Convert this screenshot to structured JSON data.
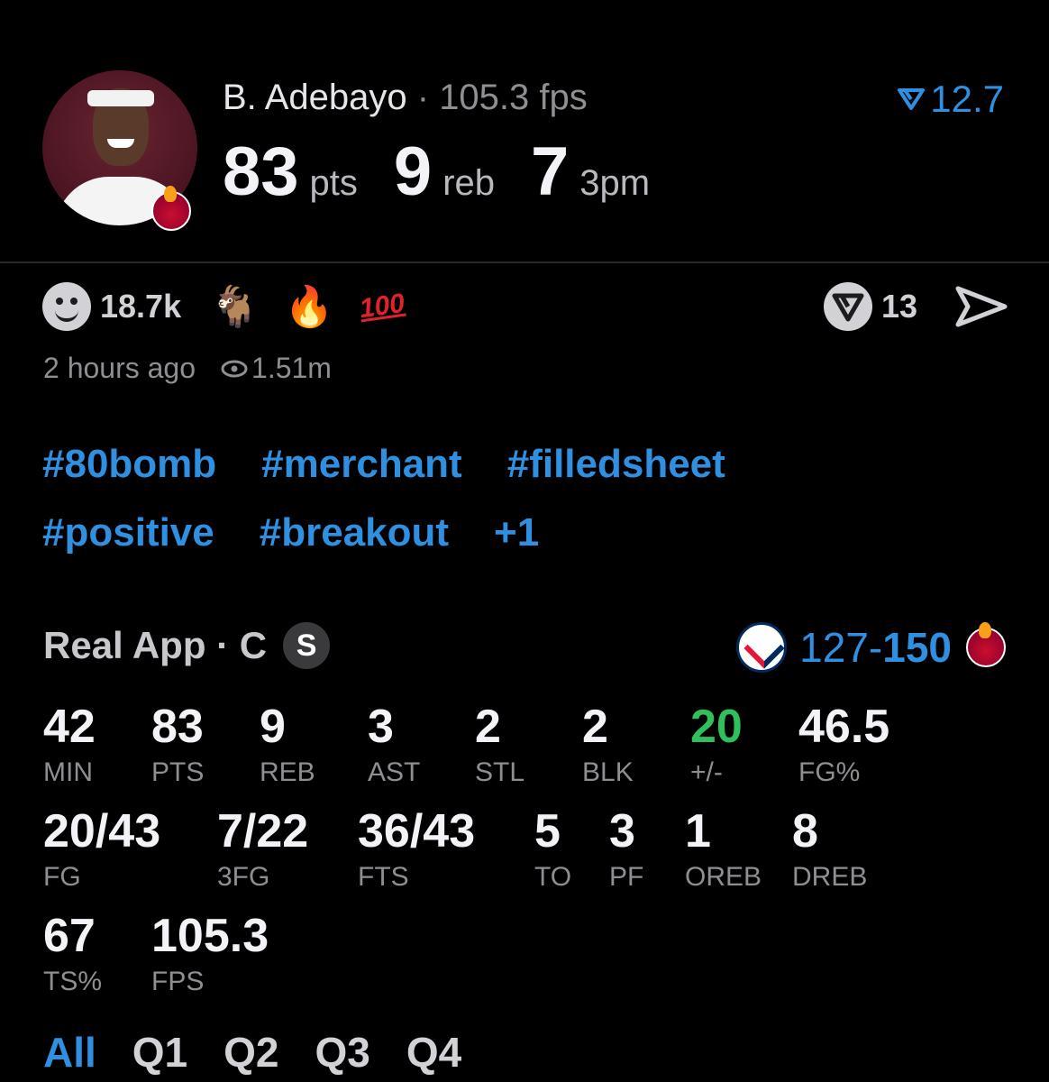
{
  "header": {
    "player_name": "B. Adebayo",
    "separator": "·",
    "fps_text": "105.3 fps",
    "rank_value": "12.7",
    "headline_stats": [
      {
        "value": "83",
        "unit": "pts"
      },
      {
        "value": "9",
        "unit": "reb"
      },
      {
        "value": "7",
        "unit": "3pm"
      }
    ]
  },
  "reactions": {
    "count": "18.7k",
    "emojis": [
      "🐐",
      "🔥"
    ],
    "hundred": "100",
    "share_count": "13"
  },
  "meta": {
    "time_ago": "2 hours ago",
    "views": "1.51m"
  },
  "tags": {
    "row1": [
      "#80bomb",
      "#merchant",
      "#filledsheet"
    ],
    "row2": [
      "#positive",
      "#breakout",
      "+1"
    ]
  },
  "game": {
    "source": "Real App · C",
    "badge": "S",
    "score_away": "127",
    "score_dash": "-",
    "score_home": "150"
  },
  "stats": {
    "row1": [
      {
        "value": "42",
        "label": "MIN"
      },
      {
        "value": "83",
        "label": "PTS"
      },
      {
        "value": "9",
        "label": "REB"
      },
      {
        "value": "3",
        "label": "AST"
      },
      {
        "value": "2",
        "label": "STL"
      },
      {
        "value": "2",
        "label": "BLK"
      },
      {
        "value": "20",
        "label": "+/-"
      },
      {
        "value": "46.5",
        "label": "FG%"
      }
    ],
    "row2": [
      {
        "value": "20/43",
        "label": "FG"
      },
      {
        "value": "7/22",
        "label": "3FG"
      },
      {
        "value": "36/43",
        "label": "FTS"
      },
      {
        "value": "5",
        "label": "TO"
      },
      {
        "value": "3",
        "label": "PF"
      },
      {
        "value": "1",
        "label": "OREB"
      },
      {
        "value": "8",
        "label": "DREB"
      }
    ],
    "row3": [
      {
        "value": "67",
        "label": "TS%"
      },
      {
        "value": "105.3",
        "label": "FPS"
      }
    ]
  },
  "quarters": {
    "tabs": [
      "All",
      "Q1",
      "Q2",
      "Q3",
      "Q4"
    ],
    "active": "All"
  },
  "colors": {
    "accent": "#2f8fe0",
    "positive": "#2fbf5b",
    "background": "#000000"
  }
}
